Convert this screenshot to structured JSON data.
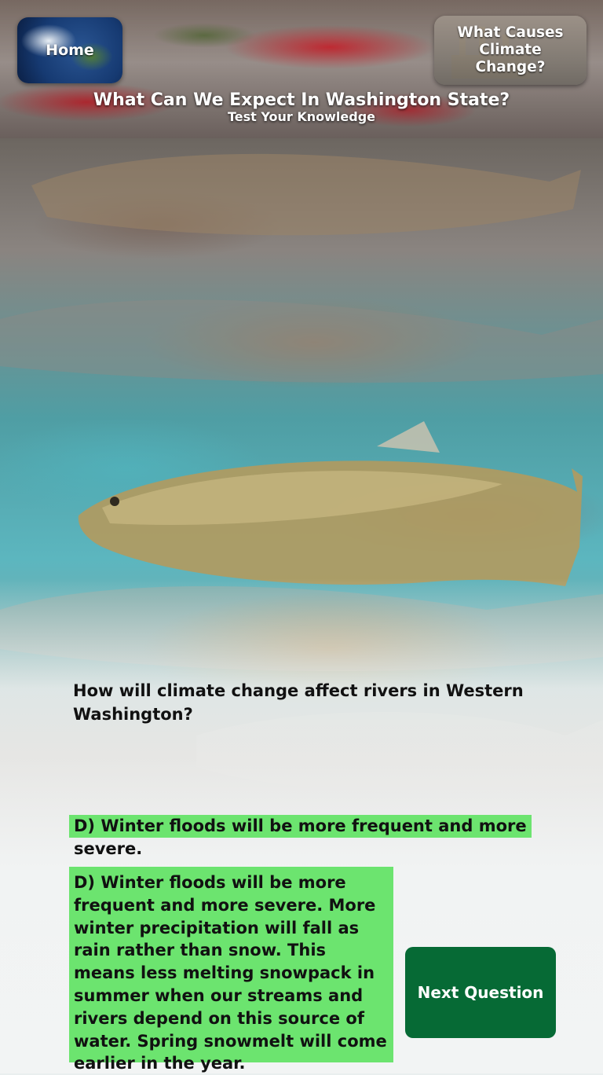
{
  "header": {
    "home_label": "Home",
    "causes_label": "What Causes Climate Change?",
    "title": "What Can We Expect In Washington State?",
    "subtitle": "Test Your Knowledge"
  },
  "quiz": {
    "question": "How will climate change affect rivers in Western Washington?",
    "selected_answer": "D) Winter floods will be more frequent and more severe.",
    "explanation": "D) Winter floods will be more frequent and more severe. More winter precipitation will fall as rain rather than snow. This means less melting snowpack in summer when our streams and rivers depend on this source of water. Spring snowmelt will come earlier in the year.",
    "next_label": "Next Question"
  },
  "colors": {
    "answer_highlight": "#6ce46f",
    "next_button": "#066a35"
  },
  "icons": {
    "home": "earth-globe-icon",
    "causes": "factory-icon"
  }
}
